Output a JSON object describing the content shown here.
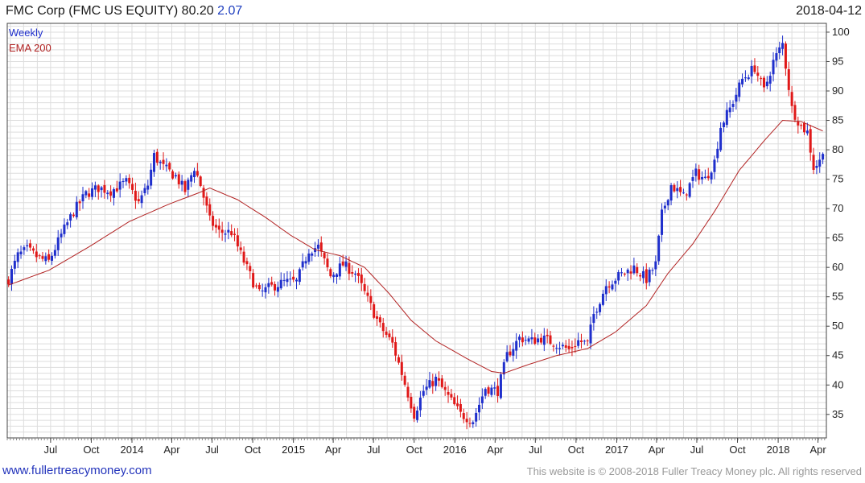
{
  "header": {
    "title": "FMC Corp (FMC US EQUITY) 80.20",
    "change": "2.07",
    "date": "2018-04-12"
  },
  "footer": {
    "site": "www.fullertreacymoney.com",
    "copyright": "This website is © 2008-2018 Fuller Treacy Money plc. All rights reserved"
  },
  "colors": {
    "up": "#1f2fcc",
    "down": "#e01818",
    "ema": "#b22222",
    "grid": "#dddddd",
    "frame": "#444444"
  },
  "chart_data": {
    "type": "candlestick",
    "legend": [
      "Weekly",
      "EMA 200"
    ],
    "legend_position": "top-left",
    "frequency": "weekly",
    "ylim": [
      31,
      101.5
    ],
    "yticks": [
      35,
      40,
      45,
      50,
      55,
      60,
      65,
      70,
      75,
      80,
      85,
      90,
      95,
      100
    ],
    "y_axis_side": "right",
    "grid": true,
    "xlim": [
      "2013-03-25",
      "2018-04-20"
    ],
    "xticks": [
      {
        "label": "Jul",
        "date": "2013-07-01"
      },
      {
        "label": "Oct",
        "date": "2013-10-01"
      },
      {
        "label": "2014",
        "date": "2014-01-01"
      },
      {
        "label": "Apr",
        "date": "2014-04-01"
      },
      {
        "label": "Jul",
        "date": "2014-07-01"
      },
      {
        "label": "Oct",
        "date": "2014-10-01"
      },
      {
        "label": "2015",
        "date": "2015-01-01"
      },
      {
        "label": "Apr",
        "date": "2015-04-01"
      },
      {
        "label": "Jul",
        "date": "2015-07-01"
      },
      {
        "label": "Oct",
        "date": "2015-10-01"
      },
      {
        "label": "2016",
        "date": "2016-01-01"
      },
      {
        "label": "Apr",
        "date": "2016-04-01"
      },
      {
        "label": "Jul",
        "date": "2016-07-01"
      },
      {
        "label": "Oct",
        "date": "2016-10-01"
      },
      {
        "label": "2017",
        "date": "2017-01-01"
      },
      {
        "label": "Apr",
        "date": "2017-04-01"
      },
      {
        "label": "Jul",
        "date": "2017-07-01"
      },
      {
        "label": "Oct",
        "date": "2017-10-01"
      },
      {
        "label": "2018",
        "date": "2018-01-01"
      },
      {
        "label": "Apr",
        "date": "2018-04-01"
      }
    ],
    "price_anchors": [
      [
        "2013-03-28",
        58
      ],
      [
        "2013-04-18",
        62
      ],
      [
        "2013-05-09",
        63
      ],
      [
        "2013-06-06",
        61.5
      ],
      [
        "2013-06-27",
        61
      ],
      [
        "2013-07-25",
        65.5
      ],
      [
        "2013-08-22",
        69.5
      ],
      [
        "2013-09-19",
        72.5
      ],
      [
        "2013-10-17",
        73.5
      ],
      [
        "2013-11-14",
        73
      ],
      [
        "2013-12-19",
        74.5
      ],
      [
        "2014-01-16",
        71
      ],
      [
        "2014-02-06",
        74
      ],
      [
        "2014-02-20",
        79
      ],
      [
        "2014-03-13",
        77
      ],
      [
        "2014-04-10",
        75.5
      ],
      [
        "2014-05-01",
        73
      ],
      [
        "2014-05-22",
        77
      ],
      [
        "2014-06-05",
        74
      ],
      [
        "2014-06-26",
        68
      ],
      [
        "2014-07-17",
        66
      ],
      [
        "2014-08-14",
        66
      ],
      [
        "2014-09-11",
        61
      ],
      [
        "2014-10-02",
        57.5
      ],
      [
        "2014-10-16",
        55.5
      ],
      [
        "2014-11-06",
        56.5
      ],
      [
        "2014-12-11",
        57.5
      ],
      [
        "2015-01-08",
        57.5
      ],
      [
        "2015-02-05",
        63
      ],
      [
        "2015-02-26",
        63.5
      ],
      [
        "2015-03-26",
        58.5
      ],
      [
        "2015-04-23",
        60.5
      ],
      [
        "2015-05-21",
        59
      ],
      [
        "2015-06-18",
        54.5
      ],
      [
        "2015-07-16",
        50
      ],
      [
        "2015-08-13",
        47
      ],
      [
        "2015-09-03",
        42
      ],
      [
        "2015-10-01",
        35
      ],
      [
        "2015-10-22",
        39
      ],
      [
        "2015-11-19",
        41
      ],
      [
        "2015-12-17",
        38
      ],
      [
        "2016-01-14",
        35
      ],
      [
        "2016-02-11",
        34
      ],
      [
        "2016-03-10",
        39.5
      ],
      [
        "2016-04-07",
        39
      ],
      [
        "2016-04-28",
        45
      ],
      [
        "2016-05-26",
        48
      ],
      [
        "2016-06-23",
        47.5
      ],
      [
        "2016-07-14",
        48
      ],
      [
        "2016-08-18",
        47
      ],
      [
        "2016-09-15",
        46
      ],
      [
        "2016-10-06",
        47.5
      ],
      [
        "2016-10-27",
        47
      ],
      [
        "2016-11-10",
        52
      ],
      [
        "2016-12-08",
        57
      ],
      [
        "2017-01-05",
        58.5
      ],
      [
        "2017-02-09",
        60
      ],
      [
        "2017-03-09",
        58
      ],
      [
        "2017-03-30",
        60.5
      ],
      [
        "2017-04-13",
        69
      ],
      [
        "2017-05-04",
        74
      ],
      [
        "2017-06-01",
        72
      ],
      [
        "2017-06-29",
        76
      ],
      [
        "2017-07-20",
        75
      ],
      [
        "2017-08-10",
        78
      ],
      [
        "2017-08-24",
        84
      ],
      [
        "2017-09-14",
        87
      ],
      [
        "2017-10-12",
        92
      ],
      [
        "2017-11-09",
        94
      ],
      [
        "2017-11-30",
        90
      ],
      [
        "2017-12-21",
        95
      ],
      [
        "2018-01-04",
        97
      ],
      [
        "2018-01-11",
        98
      ],
      [
        "2018-02-01",
        87
      ],
      [
        "2018-02-22",
        84
      ],
      [
        "2018-03-08",
        83
      ],
      [
        "2018-03-22",
        77
      ],
      [
        "2018-04-05",
        78
      ],
      [
        "2018-04-12",
        80.2
      ]
    ],
    "ema_anchors": [
      [
        "2013-03-28",
        57
      ],
      [
        "2013-06-27",
        59.5
      ],
      [
        "2013-09-26",
        63.5
      ],
      [
        "2013-12-26",
        67.8
      ],
      [
        "2014-03-27",
        70.8
      ],
      [
        "2014-06-05",
        72.8
      ],
      [
        "2014-06-26",
        73.5
      ],
      [
        "2014-08-28",
        71.5
      ],
      [
        "2014-10-30",
        68.5
      ],
      [
        "2014-12-25",
        65.5
      ],
      [
        "2015-02-19",
        63
      ],
      [
        "2015-04-16",
        62
      ],
      [
        "2015-06-11",
        60
      ],
      [
        "2015-08-06",
        55.5
      ],
      [
        "2015-09-24",
        51
      ],
      [
        "2015-11-19",
        47.5
      ],
      [
        "2016-01-28",
        44.5
      ],
      [
        "2016-03-24",
        42.3
      ],
      [
        "2016-04-21",
        42
      ],
      [
        "2016-06-16",
        43.5
      ],
      [
        "2016-08-18",
        45
      ],
      [
        "2016-10-27",
        46.2
      ],
      [
        "2016-12-29",
        49
      ],
      [
        "2017-03-09",
        53.5
      ],
      [
        "2017-04-27",
        59
      ],
      [
        "2017-06-22",
        64
      ],
      [
        "2017-08-10",
        69.5
      ],
      [
        "2017-10-05",
        76.5
      ],
      [
        "2017-11-30",
        81.5
      ],
      [
        "2018-01-11",
        85
      ],
      [
        "2018-02-22",
        84.8
      ],
      [
        "2018-04-12",
        83.2
      ]
    ]
  }
}
